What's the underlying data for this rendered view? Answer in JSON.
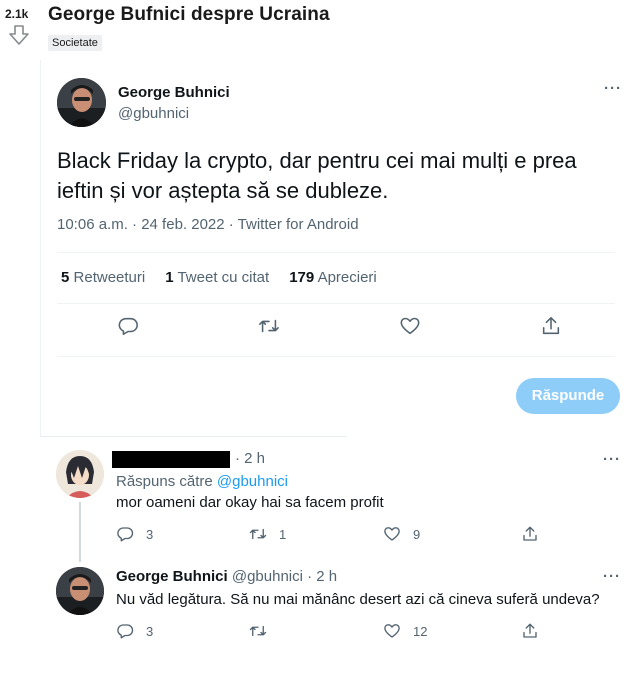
{
  "post": {
    "score": "2.1k",
    "title": "George Bufnici despre Ucraina",
    "flair": "Societate"
  },
  "tweet": {
    "author_name": "George Buhnici",
    "author_handle": "@gbuhnici",
    "more": "···",
    "text": "Black Friday la crypto, dar pentru cei mai mulți e prea ieftin și vor aștepta să se dubleze.",
    "meta": "10:06 a.m. · 24 feb. 2022 · Twitter for Android",
    "stats": {
      "retweets_count": "5",
      "retweets_label": "Retweeturi",
      "quotes_count": "1",
      "quotes_label": "Tweet cu citat",
      "likes_count": "179",
      "likes_label": "Aprecieri"
    },
    "reply_button": "Răspunde"
  },
  "replies": [
    {
      "time": "· 2 h",
      "more": "···",
      "replying_prefix": "Răspuns către",
      "replying_handle": "@gbuhnici",
      "text": "mor oameni dar okay hai sa facem profit",
      "reply_count": "3",
      "retweet_count": "1",
      "like_count": "9"
    },
    {
      "author_name": "George Buhnici",
      "author_handle": "@gbuhnici · 2 h",
      "more": "···",
      "text": "Nu văd legătura. Să nu mai mănânc desert azi că cineva suferă undeva?",
      "reply_count": "3",
      "retweet_count": "",
      "like_count": "12"
    }
  ],
  "icons": {
    "downvote": "downvote-arrow-icon",
    "reply": "comment-bubble-icon",
    "retweet": "retweet-icon",
    "like": "heart-icon",
    "share": "share-icon"
  },
  "colors": {
    "accent": "#1d9bf0",
    "reply_button": "#8ecdf8",
    "secondary_text": "#536471"
  }
}
